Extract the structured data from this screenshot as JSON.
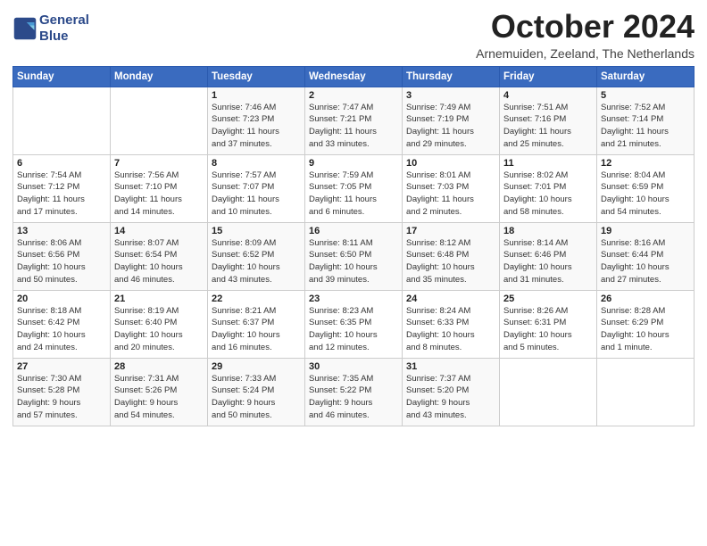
{
  "header": {
    "logo_line1": "General",
    "logo_line2": "Blue",
    "month_title": "October 2024",
    "subtitle": "Arnemuiden, Zeeland, The Netherlands"
  },
  "days_of_week": [
    "Sunday",
    "Monday",
    "Tuesday",
    "Wednesday",
    "Thursday",
    "Friday",
    "Saturday"
  ],
  "weeks": [
    [
      {
        "day": "",
        "info": ""
      },
      {
        "day": "",
        "info": ""
      },
      {
        "day": "1",
        "info": "Sunrise: 7:46 AM\nSunset: 7:23 PM\nDaylight: 11 hours\nand 37 minutes."
      },
      {
        "day": "2",
        "info": "Sunrise: 7:47 AM\nSunset: 7:21 PM\nDaylight: 11 hours\nand 33 minutes."
      },
      {
        "day": "3",
        "info": "Sunrise: 7:49 AM\nSunset: 7:19 PM\nDaylight: 11 hours\nand 29 minutes."
      },
      {
        "day": "4",
        "info": "Sunrise: 7:51 AM\nSunset: 7:16 PM\nDaylight: 11 hours\nand 25 minutes."
      },
      {
        "day": "5",
        "info": "Sunrise: 7:52 AM\nSunset: 7:14 PM\nDaylight: 11 hours\nand 21 minutes."
      }
    ],
    [
      {
        "day": "6",
        "info": "Sunrise: 7:54 AM\nSunset: 7:12 PM\nDaylight: 11 hours\nand 17 minutes."
      },
      {
        "day": "7",
        "info": "Sunrise: 7:56 AM\nSunset: 7:10 PM\nDaylight: 11 hours\nand 14 minutes."
      },
      {
        "day": "8",
        "info": "Sunrise: 7:57 AM\nSunset: 7:07 PM\nDaylight: 11 hours\nand 10 minutes."
      },
      {
        "day": "9",
        "info": "Sunrise: 7:59 AM\nSunset: 7:05 PM\nDaylight: 11 hours\nand 6 minutes."
      },
      {
        "day": "10",
        "info": "Sunrise: 8:01 AM\nSunset: 7:03 PM\nDaylight: 11 hours\nand 2 minutes."
      },
      {
        "day": "11",
        "info": "Sunrise: 8:02 AM\nSunset: 7:01 PM\nDaylight: 10 hours\nand 58 minutes."
      },
      {
        "day": "12",
        "info": "Sunrise: 8:04 AM\nSunset: 6:59 PM\nDaylight: 10 hours\nand 54 minutes."
      }
    ],
    [
      {
        "day": "13",
        "info": "Sunrise: 8:06 AM\nSunset: 6:56 PM\nDaylight: 10 hours\nand 50 minutes."
      },
      {
        "day": "14",
        "info": "Sunrise: 8:07 AM\nSunset: 6:54 PM\nDaylight: 10 hours\nand 46 minutes."
      },
      {
        "day": "15",
        "info": "Sunrise: 8:09 AM\nSunset: 6:52 PM\nDaylight: 10 hours\nand 43 minutes."
      },
      {
        "day": "16",
        "info": "Sunrise: 8:11 AM\nSunset: 6:50 PM\nDaylight: 10 hours\nand 39 minutes."
      },
      {
        "day": "17",
        "info": "Sunrise: 8:12 AM\nSunset: 6:48 PM\nDaylight: 10 hours\nand 35 minutes."
      },
      {
        "day": "18",
        "info": "Sunrise: 8:14 AM\nSunset: 6:46 PM\nDaylight: 10 hours\nand 31 minutes."
      },
      {
        "day": "19",
        "info": "Sunrise: 8:16 AM\nSunset: 6:44 PM\nDaylight: 10 hours\nand 27 minutes."
      }
    ],
    [
      {
        "day": "20",
        "info": "Sunrise: 8:18 AM\nSunset: 6:42 PM\nDaylight: 10 hours\nand 24 minutes."
      },
      {
        "day": "21",
        "info": "Sunrise: 8:19 AM\nSunset: 6:40 PM\nDaylight: 10 hours\nand 20 minutes."
      },
      {
        "day": "22",
        "info": "Sunrise: 8:21 AM\nSunset: 6:37 PM\nDaylight: 10 hours\nand 16 minutes."
      },
      {
        "day": "23",
        "info": "Sunrise: 8:23 AM\nSunset: 6:35 PM\nDaylight: 10 hours\nand 12 minutes."
      },
      {
        "day": "24",
        "info": "Sunrise: 8:24 AM\nSunset: 6:33 PM\nDaylight: 10 hours\nand 8 minutes."
      },
      {
        "day": "25",
        "info": "Sunrise: 8:26 AM\nSunset: 6:31 PM\nDaylight: 10 hours\nand 5 minutes."
      },
      {
        "day": "26",
        "info": "Sunrise: 8:28 AM\nSunset: 6:29 PM\nDaylight: 10 hours\nand 1 minute."
      }
    ],
    [
      {
        "day": "27",
        "info": "Sunrise: 7:30 AM\nSunset: 5:28 PM\nDaylight: 9 hours\nand 57 minutes."
      },
      {
        "day": "28",
        "info": "Sunrise: 7:31 AM\nSunset: 5:26 PM\nDaylight: 9 hours\nand 54 minutes."
      },
      {
        "day": "29",
        "info": "Sunrise: 7:33 AM\nSunset: 5:24 PM\nDaylight: 9 hours\nand 50 minutes."
      },
      {
        "day": "30",
        "info": "Sunrise: 7:35 AM\nSunset: 5:22 PM\nDaylight: 9 hours\nand 46 minutes."
      },
      {
        "day": "31",
        "info": "Sunrise: 7:37 AM\nSunset: 5:20 PM\nDaylight: 9 hours\nand 43 minutes."
      },
      {
        "day": "",
        "info": ""
      },
      {
        "day": "",
        "info": ""
      }
    ]
  ]
}
